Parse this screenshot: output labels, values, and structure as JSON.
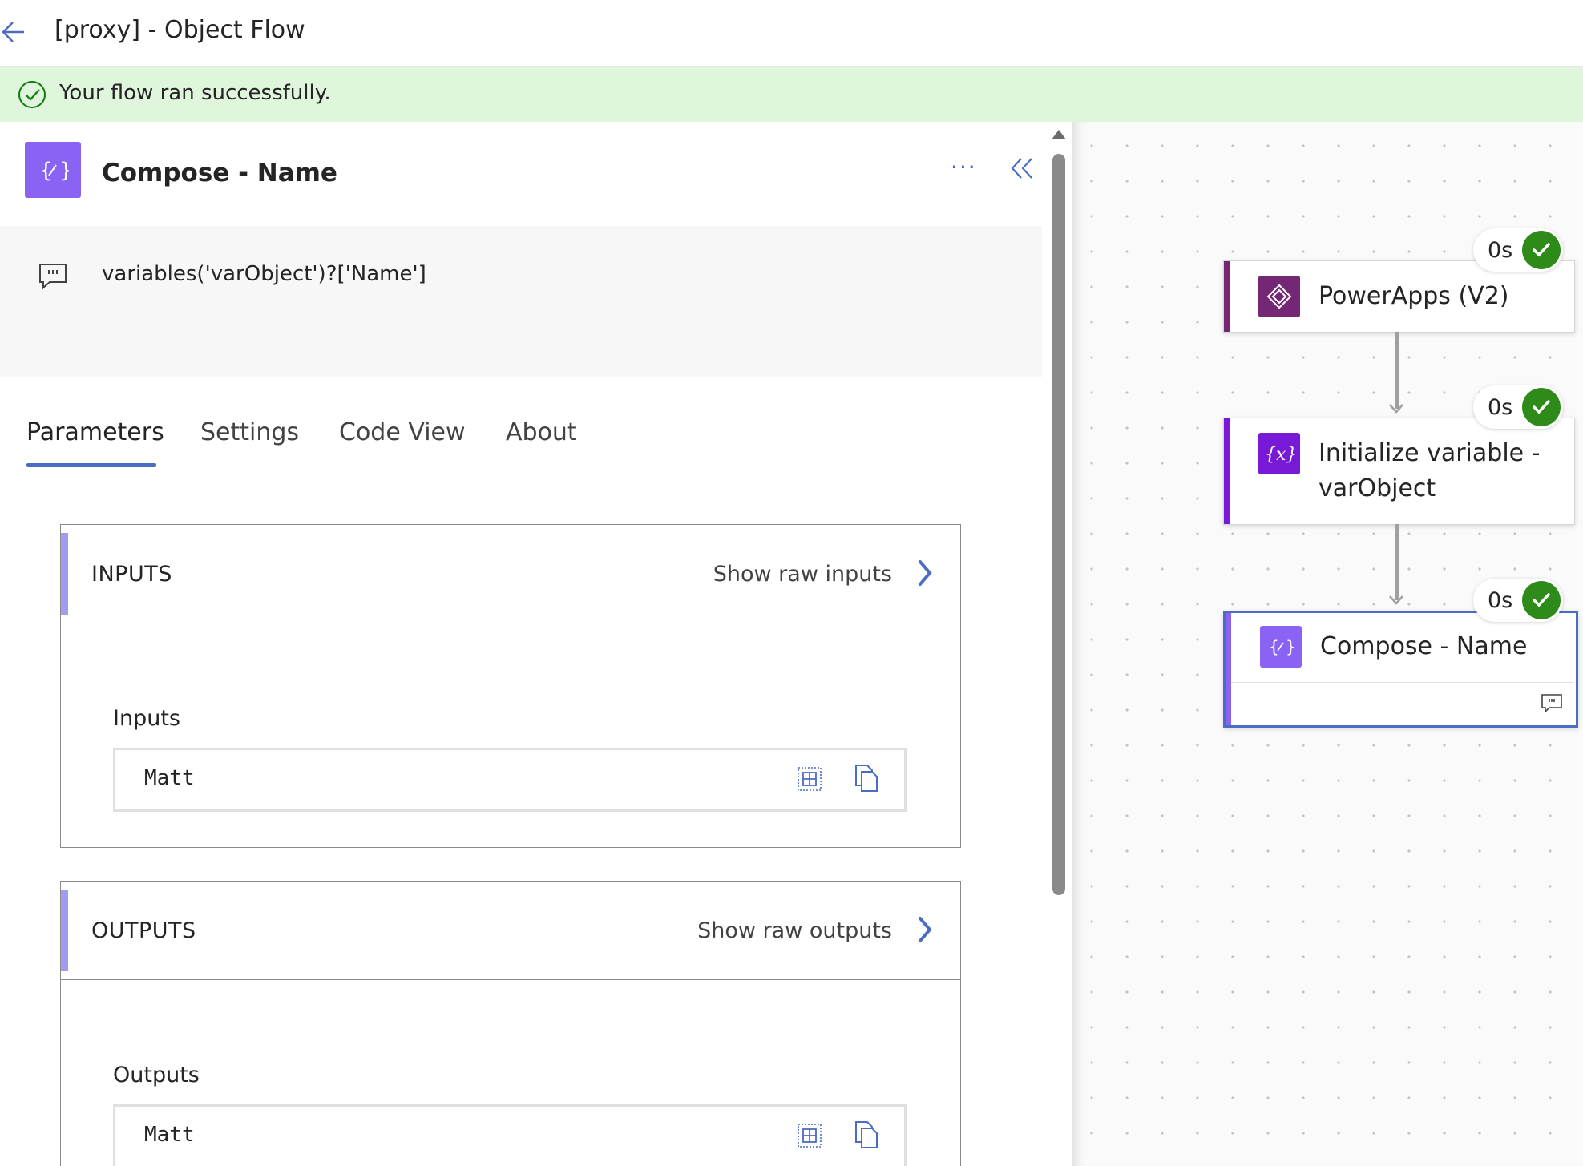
{
  "header": {
    "title": "[proxy] - Object Flow"
  },
  "banner": {
    "message": "Your flow ran successfully."
  },
  "panel": {
    "title": "Compose - Name",
    "more": "···",
    "note": "variables('varObject')?['Name']",
    "tabs": [
      {
        "label": "Parameters"
      },
      {
        "label": "Settings"
      },
      {
        "label": "Code View"
      },
      {
        "label": "About"
      }
    ],
    "inputs": {
      "title": "INPUTS",
      "raw_link": "Show raw inputs",
      "field_label": "Inputs",
      "value": "Matt"
    },
    "outputs": {
      "title": "OUTPUTS",
      "raw_link": "Show raw outputs",
      "field_label": "Outputs",
      "value": "Matt"
    }
  },
  "canvas": {
    "nodes": [
      {
        "label": "PowerApps (V2)",
        "duration": "0s",
        "icon": "powerapps-icon",
        "color": "#742774"
      },
      {
        "label": "Initialize variable -\nvarObject",
        "label_line1": "Initialize variable -",
        "label_line2": "varObject",
        "duration": "0s",
        "icon": "variable-icon",
        "color": "#7719d7"
      },
      {
        "label": "Compose - Name",
        "duration": "0s",
        "icon": "compose-icon",
        "color": "#8a63f5"
      }
    ]
  },
  "colors": {
    "accent": "#4a6cc4",
    "success": "#2e8b1a",
    "banner": "#dff6dd",
    "compose": "#8a63f5"
  }
}
